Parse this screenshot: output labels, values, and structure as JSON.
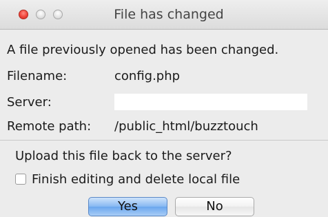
{
  "window": {
    "title": "File has changed"
  },
  "message": "A file previously opened has been changed.",
  "fields": {
    "filename_label": "Filename:",
    "filename_value": "config.php",
    "server_label": "Server:",
    "server_value": "",
    "remote_path_label": "Remote path:",
    "remote_path_value": "/public_html/buzztouch"
  },
  "question": "Upload this file back to the server?",
  "checkbox": {
    "label": "Finish editing and delete local file",
    "checked": false
  },
  "buttons": {
    "yes_label": "Yes",
    "no_label": "No"
  },
  "colors": {
    "window_bg": "#ececec",
    "close_red": "#f0443a",
    "default_button_blue": "#86b8f2"
  }
}
